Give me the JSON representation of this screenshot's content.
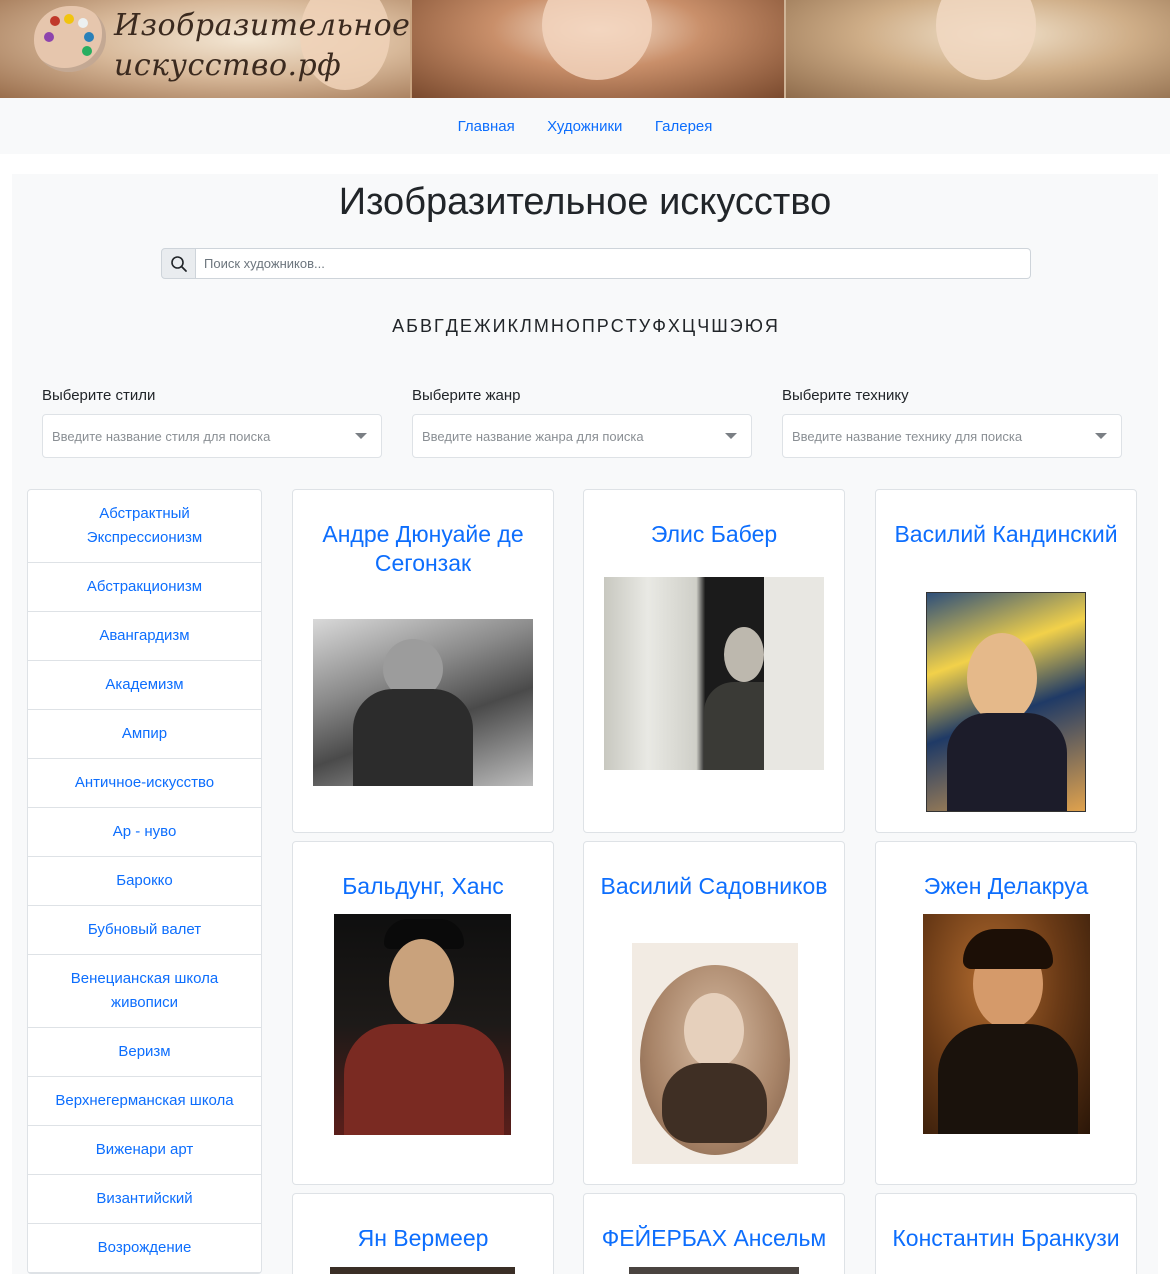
{
  "header": {
    "logo_text": "Изобразительное искусство.рф"
  },
  "topnav": {
    "items": [
      "Главная",
      "Художники",
      "Галерея"
    ]
  },
  "main": {
    "title": "Изобразительное искусство",
    "search_placeholder": "Поиск художников...",
    "alphabet": [
      "А",
      "Б",
      "В",
      "Г",
      "Д",
      "Е",
      "Ж",
      "И",
      "К",
      "Л",
      "М",
      "Н",
      "О",
      "П",
      "Р",
      "С",
      "Т",
      "У",
      "Ф",
      "Х",
      "Ц",
      "Ч",
      "Ш",
      "Э",
      "Ю",
      "Я"
    ]
  },
  "filters": {
    "style": {
      "label": "Выберите стили",
      "placeholder": "Введите название стиля для поиска"
    },
    "genre": {
      "label": "Выберите жанр",
      "placeholder": "Введите название жанра для поиска"
    },
    "technique": {
      "label": "Выберите технику",
      "placeholder": "Введите название технику для поиска"
    }
  },
  "sidebar": {
    "items": [
      "Абстрактный Экспрессионизм",
      "Абстракционизм",
      "Авангардизм",
      "Академизм",
      "Ампир",
      "Античное-искусство",
      "Ар - нуво",
      "Барокко",
      "Бубновый валет",
      "Венецианская школа живописи",
      "Веризм",
      "Верхнегерманская школа",
      "Виженари арт",
      "Византийский",
      "Возрождение"
    ]
  },
  "artists": [
    {
      "name": "Андре Дюнуайе де Сегонзак",
      "photo": "artist-photo-bw"
    },
    {
      "name": "Элис Бабер",
      "photo": "artist-photo-bw"
    },
    {
      "name": "Василий Кандинский",
      "photo": "artist-portrait-color"
    },
    {
      "name": "Бальдунг, Ханс",
      "photo": "artist-portrait-color"
    },
    {
      "name": "Василий Садовников",
      "photo": "artist-portrait-sepia"
    },
    {
      "name": "Эжен Делакруа",
      "photo": "artist-portrait-color"
    },
    {
      "name": "Ян Вермеер",
      "photo": "artist-portrait-color"
    },
    {
      "name": "ФЕЙЕРБАХ Ансельм",
      "photo": "artist-portrait-color"
    },
    {
      "name": "Константин Бранкузи",
      "photo": "artist-photo-bw"
    }
  ]
}
